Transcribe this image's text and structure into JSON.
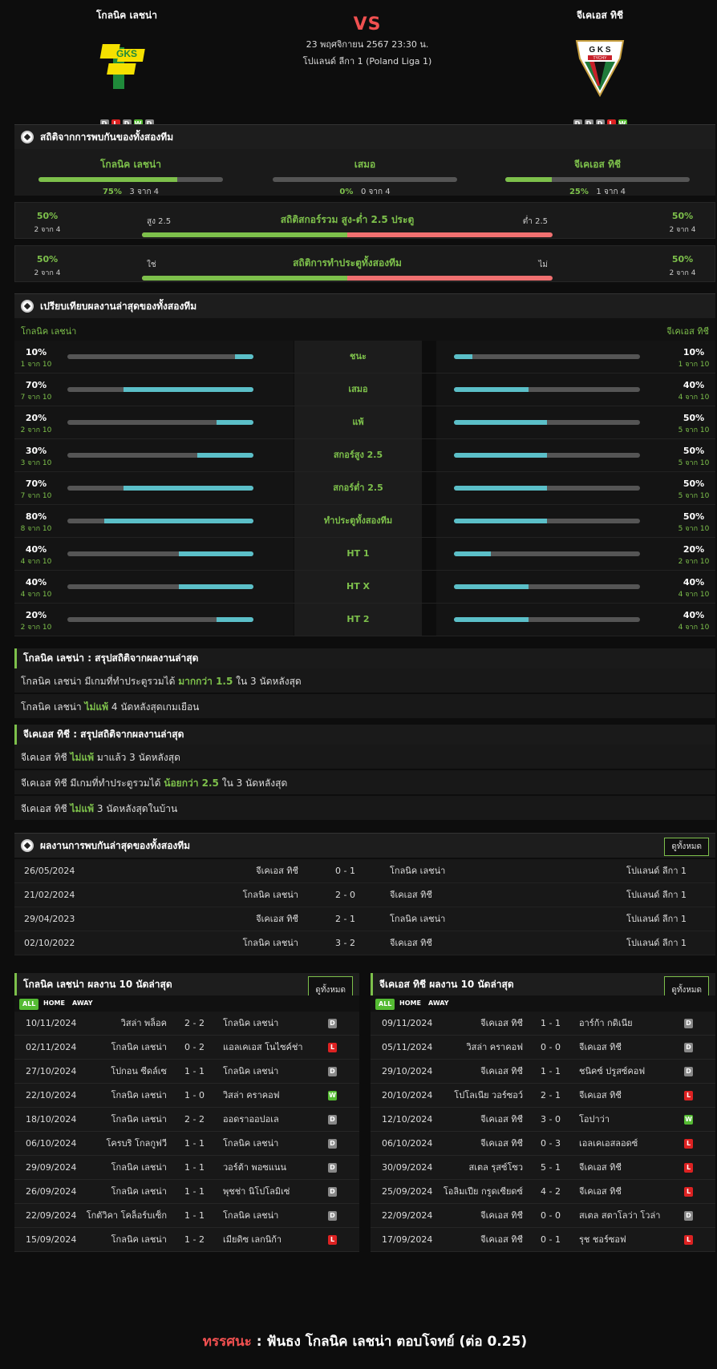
{
  "home": {
    "name": "โกลนิค เลชน่า",
    "form": [
      "D",
      "L",
      "D",
      "W",
      "D"
    ],
    "logo_text": "GKS"
  },
  "away": {
    "name": "จีเคเอส ทิชี",
    "form": [
      "D",
      "D",
      "D",
      "L",
      "W"
    ],
    "logo_text": "G K S",
    "logo_sub": "TYCHY"
  },
  "match": {
    "vs": "VS",
    "date": "23 พฤศจิกายน 2567 23:30 น.",
    "league": "โปแลนด์ ลีกา 1 (Poland Liga 1)"
  },
  "h2h_section": {
    "title": "สถิติจากการพบกันของทั้งสองทีม",
    "home": {
      "label": "โกลนิค เลชน่า",
      "pct": "75%",
      "count": "3 จาก 4",
      "value": 75
    },
    "draw": {
      "label": "เสมอ",
      "pct": "0%",
      "count": "0 จาก 4",
      "value": 0
    },
    "away": {
      "label": "จีเคเอส ทิชี",
      "pct": "25%",
      "count": "1 จาก 4",
      "value": 25
    }
  },
  "goals_ou": {
    "title": "สถิติสกอร์รวม สูง-ต่ำ 2.5 ประตู",
    "left_label": "สูง 2.5",
    "right_label": "ต่ำ 2.5",
    "left_pct": "50%",
    "left_count": "2 จาก 4",
    "right_pct": "50%",
    "right_count": "2 จาก 4",
    "value": 50
  },
  "goals_btts": {
    "title": "สถิติการทำประตูทั้งสองทีม",
    "left_label": "ใช่",
    "right_label": "ไม่",
    "left_pct": "50%",
    "left_count": "2 จาก 4",
    "right_pct": "50%",
    "right_count": "2 จาก 4",
    "value": 50
  },
  "compare": {
    "title": "เปรียบเทียบผลงานล่าสุดของทั้งสองทีม",
    "home_label": "โกลนิค เลชน่า",
    "away_label": "จีเคเอส ทิชี",
    "rows": [
      {
        "label": "ชนะ",
        "hp": "10%",
        "hc": "1 จาก 10",
        "hv": 10,
        "ap": "10%",
        "ac": "1 จาก 10",
        "av": 10
      },
      {
        "label": "เสมอ",
        "hp": "70%",
        "hc": "7 จาก 10",
        "hv": 70,
        "ap": "40%",
        "ac": "4 จาก 10",
        "av": 40
      },
      {
        "label": "แพ้",
        "hp": "20%",
        "hc": "2 จาก 10",
        "hv": 20,
        "ap": "50%",
        "ac": "5 จาก 10",
        "av": 50
      },
      {
        "label": "สกอร์สูง 2.5",
        "hp": "30%",
        "hc": "3 จาก 10",
        "hv": 30,
        "ap": "50%",
        "ac": "5 จาก 10",
        "av": 50
      },
      {
        "label": "สกอร์ต่ำ 2.5",
        "hp": "70%",
        "hc": "7 จาก 10",
        "hv": 70,
        "ap": "50%",
        "ac": "5 จาก 10",
        "av": 50
      },
      {
        "label": "ทำประตูทั้งสองทีม",
        "hp": "80%",
        "hc": "8 จาก 10",
        "hv": 80,
        "ap": "50%",
        "ac": "5 จาก 10",
        "av": 50
      },
      {
        "label": "HT 1",
        "hp": "40%",
        "hc": "4 จาก 10",
        "hv": 40,
        "ap": "20%",
        "ac": "2 จาก 10",
        "av": 20
      },
      {
        "label": "HT X",
        "hp": "40%",
        "hc": "4 จาก 10",
        "hv": 40,
        "ap": "40%",
        "ac": "4 จาก 10",
        "av": 40
      },
      {
        "label": "HT 2",
        "hp": "20%",
        "hc": "2 จาก 10",
        "hv": 20,
        "ap": "40%",
        "ac": "4 จาก 10",
        "av": 40
      }
    ]
  },
  "home_summary": {
    "title": "โกลนิค เลชน่า : สรุปสถิติจากผลงานล่าสุด",
    "lines": [
      {
        "a": "โกลนิค เลชน่า  มีเกมที่ทำประตูรวมได้ ",
        "b": "มากกว่า  1.5",
        "c": "  ใน 3 นัดหลังสุด"
      },
      {
        "a": "โกลนิค เลชน่า ",
        "b": "ไม่แพ้",
        "c": "  4  นัดหลังสุดเกมเยือน"
      }
    ]
  },
  "away_summary": {
    "title": "จีเคเอส ทิชี : สรุปสถิติจากผลงานล่าสุด",
    "lines": [
      {
        "a": "จีเคเอส ทิชี  ",
        "b": "ไม่แพ้",
        "c": "  มาแล้ว 3 นัดหลังสุด"
      },
      {
        "a": "จีเคเอส ทิชี  มีเกมที่ทำประตูรวมได้  ",
        "b": "น้อยกว่า  2.5",
        "c": "  ใน 3 นัดหลังสุด"
      },
      {
        "a": "จีเคเอส ทิชี  ",
        "b": "ไม่แพ้",
        "c": "  3  นัดหลังสุดในบ้าน"
      }
    ]
  },
  "h2h_results": {
    "title": "ผลงานการพบกันล่าสุดของทั้งสองทีม",
    "view_all": "ดูทั้งหมด",
    "rows": [
      {
        "date": "26/05/2024",
        "home": "จีเคเอส ทิชี",
        "score": "0 - 1",
        "away": "โกลนิค เลชน่า",
        "league": "โปแลนด์ ลีกา 1"
      },
      {
        "date": "21/02/2024",
        "home": "โกลนิค เลชน่า",
        "score": "2 - 0",
        "away": "จีเคเอส ทิชี",
        "league": "โปแลนด์ ลีกา 1"
      },
      {
        "date": "29/04/2023",
        "home": "จีเคเอส ทิชี",
        "score": "2 - 1",
        "away": "โกลนิค เลชน่า",
        "league": "โปแลนด์ ลีกา 1"
      },
      {
        "date": "02/10/2022",
        "home": "โกลนิค เลชน่า",
        "score": "3 - 2",
        "away": "จีเคเอส ทิชี",
        "league": "โปแลนด์ ลีกา 1"
      }
    ]
  },
  "home_last10": {
    "title": "โกลนิค เลชน่า ผลงาน 10 นัดล่าสุด",
    "view_all": "ดูทั้งหมด",
    "filters": [
      "ALL",
      "HOME",
      "AWAY"
    ],
    "rows": [
      {
        "date": "10/11/2024",
        "home": "วิสล่า พล็อค",
        "score": "2 - 2",
        "away": "โกลนิค เลชน่า",
        "r": "D"
      },
      {
        "date": "02/11/2024",
        "home": "โกลนิค เลชน่า",
        "score": "0 - 2",
        "away": "แอลเคเอส โนไซค์ช่า",
        "r": "L"
      },
      {
        "date": "27/10/2024",
        "home": "โปกอน ซีดล์เซ",
        "score": "1 - 1",
        "away": "โกลนิค เลชน่า",
        "r": "D"
      },
      {
        "date": "22/10/2024",
        "home": "โกลนิค เลชน่า",
        "score": "1 - 0",
        "away": "วิสล่า คราคอฟ",
        "r": "W"
      },
      {
        "date": "18/10/2024",
        "home": "โกลนิค เลชน่า",
        "score": "2 - 2",
        "away": "ออดราออปอเล",
        "r": "D"
      },
      {
        "date": "06/10/2024",
        "home": "โครบริ โกลกูฟวี",
        "score": "1 - 1",
        "away": "โกลนิค เลชน่า",
        "r": "D"
      },
      {
        "date": "29/09/2024",
        "home": "โกลนิค เลชน่า",
        "score": "1 - 1",
        "away": "วอร์ต้า พอซแนน",
        "r": "D"
      },
      {
        "date": "26/09/2024",
        "home": "โกลนิค เลชน่า",
        "score": "1 - 1",
        "away": "พุชช่า นิโปโลมิเซ่",
        "r": "D"
      },
      {
        "date": "22/09/2024",
        "home": "โกตัวิคา โคล็อร์บเซ็ก",
        "score": "1 - 1",
        "away": "โกลนิค เลชน่า",
        "r": "D"
      },
      {
        "date": "15/09/2024",
        "home": "โกลนิค เลชน่า",
        "score": "1 - 2",
        "away": "เมียดิซ เลกนิก้า",
        "r": "L"
      }
    ]
  },
  "away_last10": {
    "title": "จีเคเอส ทิชี ผลงาน 10 นัดล่าสุด",
    "view_all": "ดูทั้งหมด",
    "filters": [
      "ALL",
      "HOME",
      "AWAY"
    ],
    "rows": [
      {
        "date": "09/11/2024",
        "home": "จีเคเอส ทิชี",
        "score": "1 - 1",
        "away": "อาร์ก้า กดิเนีย",
        "r": "D"
      },
      {
        "date": "05/11/2024",
        "home": "วิสล่า คราคอฟ",
        "score": "0 - 0",
        "away": "จีเคเอส ทิชี",
        "r": "D"
      },
      {
        "date": "29/10/2024",
        "home": "จีเคเอส ทิชี",
        "score": "1 - 1",
        "away": "ชนิคซ์ ปรูสซ์คอฟ",
        "r": "D"
      },
      {
        "date": "20/10/2024",
        "home": "โปโลเนีย วอร์ซอว์",
        "score": "2 - 1",
        "away": "จีเคเอส ทิชี",
        "r": "L"
      },
      {
        "date": "12/10/2024",
        "home": "จีเคเอส ทิชี",
        "score": "3 - 0",
        "away": "โอปาว่า",
        "r": "W"
      },
      {
        "date": "06/10/2024",
        "home": "จีเคเอส ทิชี",
        "score": "0 - 3",
        "away": "เอลเคเอสลอดซ์",
        "r": "L"
      },
      {
        "date": "30/09/2024",
        "home": "สเตล รุสซ์โซว",
        "score": "5 - 1",
        "away": "จีเคเอส ทิชี",
        "r": "L"
      },
      {
        "date": "25/09/2024",
        "home": "โอลิมเปีย กรูดเซียดซ์",
        "score": "4 - 2",
        "away": "จีเคเอส ทิชี",
        "r": "L"
      },
      {
        "date": "22/09/2024",
        "home": "จีเคเอส ทิชี",
        "score": "0 - 0",
        "away": "สเตล สตาโลว่า โวล่า",
        "r": "D"
      },
      {
        "date": "17/09/2024",
        "home": "จีเคเอส ทิชี",
        "score": "0 - 1",
        "away": "รุช ชอร์ซอฟ",
        "r": "L"
      }
    ]
  },
  "verdict": {
    "label": "ทรรศนะ",
    "text": " :  ฟันธง โกลนิค เลชน่า ตอบโจทย์ (ต่อ 0.25)"
  },
  "colors": {
    "accent": "#7dc04b",
    "bar_teal": "#5bbfc8",
    "vs_red": "#f05050"
  }
}
